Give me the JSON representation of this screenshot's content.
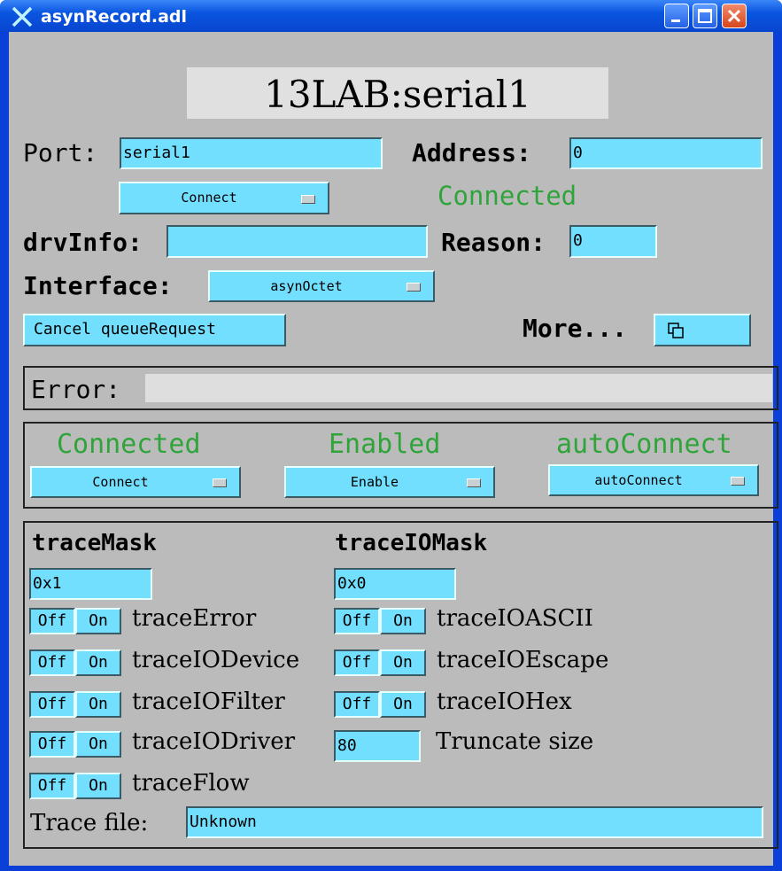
{
  "window": {
    "title": "asynRecord.adl"
  },
  "header": {
    "record_name": "13LAB:serial1"
  },
  "port": {
    "label": "Port:",
    "value": "serial1"
  },
  "address": {
    "label": "Address:",
    "value": "0"
  },
  "connect_menu": {
    "value": "Connect"
  },
  "connection_status": "Connected",
  "drvinfo": {
    "label": "drvInfo:",
    "value": ""
  },
  "reason": {
    "label": "Reason:",
    "value": "0"
  },
  "interface": {
    "label": "Interface:",
    "value": "asynOctet"
  },
  "cancel_button": "Cancel queueRequest",
  "more": {
    "label": "More...",
    "icon": "related-display-icon"
  },
  "error": {
    "label": "Error:",
    "value": ""
  },
  "status": {
    "connected": {
      "label": "Connected",
      "menu": "Connect"
    },
    "enabled": {
      "label": "Enabled",
      "menu": "Enable"
    },
    "autoconnect": {
      "label": "autoConnect",
      "menu": "autoConnect"
    }
  },
  "trace": {
    "tracemask_label": "traceMask",
    "tracemask_value": "0x1",
    "traceiomask_label": "traceIOMask",
    "traceiomask_value": "0x0",
    "off": "Off",
    "on": "On",
    "left_items": [
      "traceError",
      "traceIODevice",
      "traceIOFilter",
      "traceIODriver",
      "traceFlow"
    ],
    "right_items": [
      "traceIOASCII",
      "traceIOEscape",
      "traceIOHex"
    ],
    "truncate_value": "80",
    "truncate_label": "Truncate size",
    "file_label": "Trace file:",
    "file_value": "Unknown"
  },
  "colors": {
    "field_bg": "#73dfff",
    "panel_bg": "#bbbbbb",
    "status_green": "#2fa43a",
    "titlebar_blue": "#0a55e0"
  }
}
